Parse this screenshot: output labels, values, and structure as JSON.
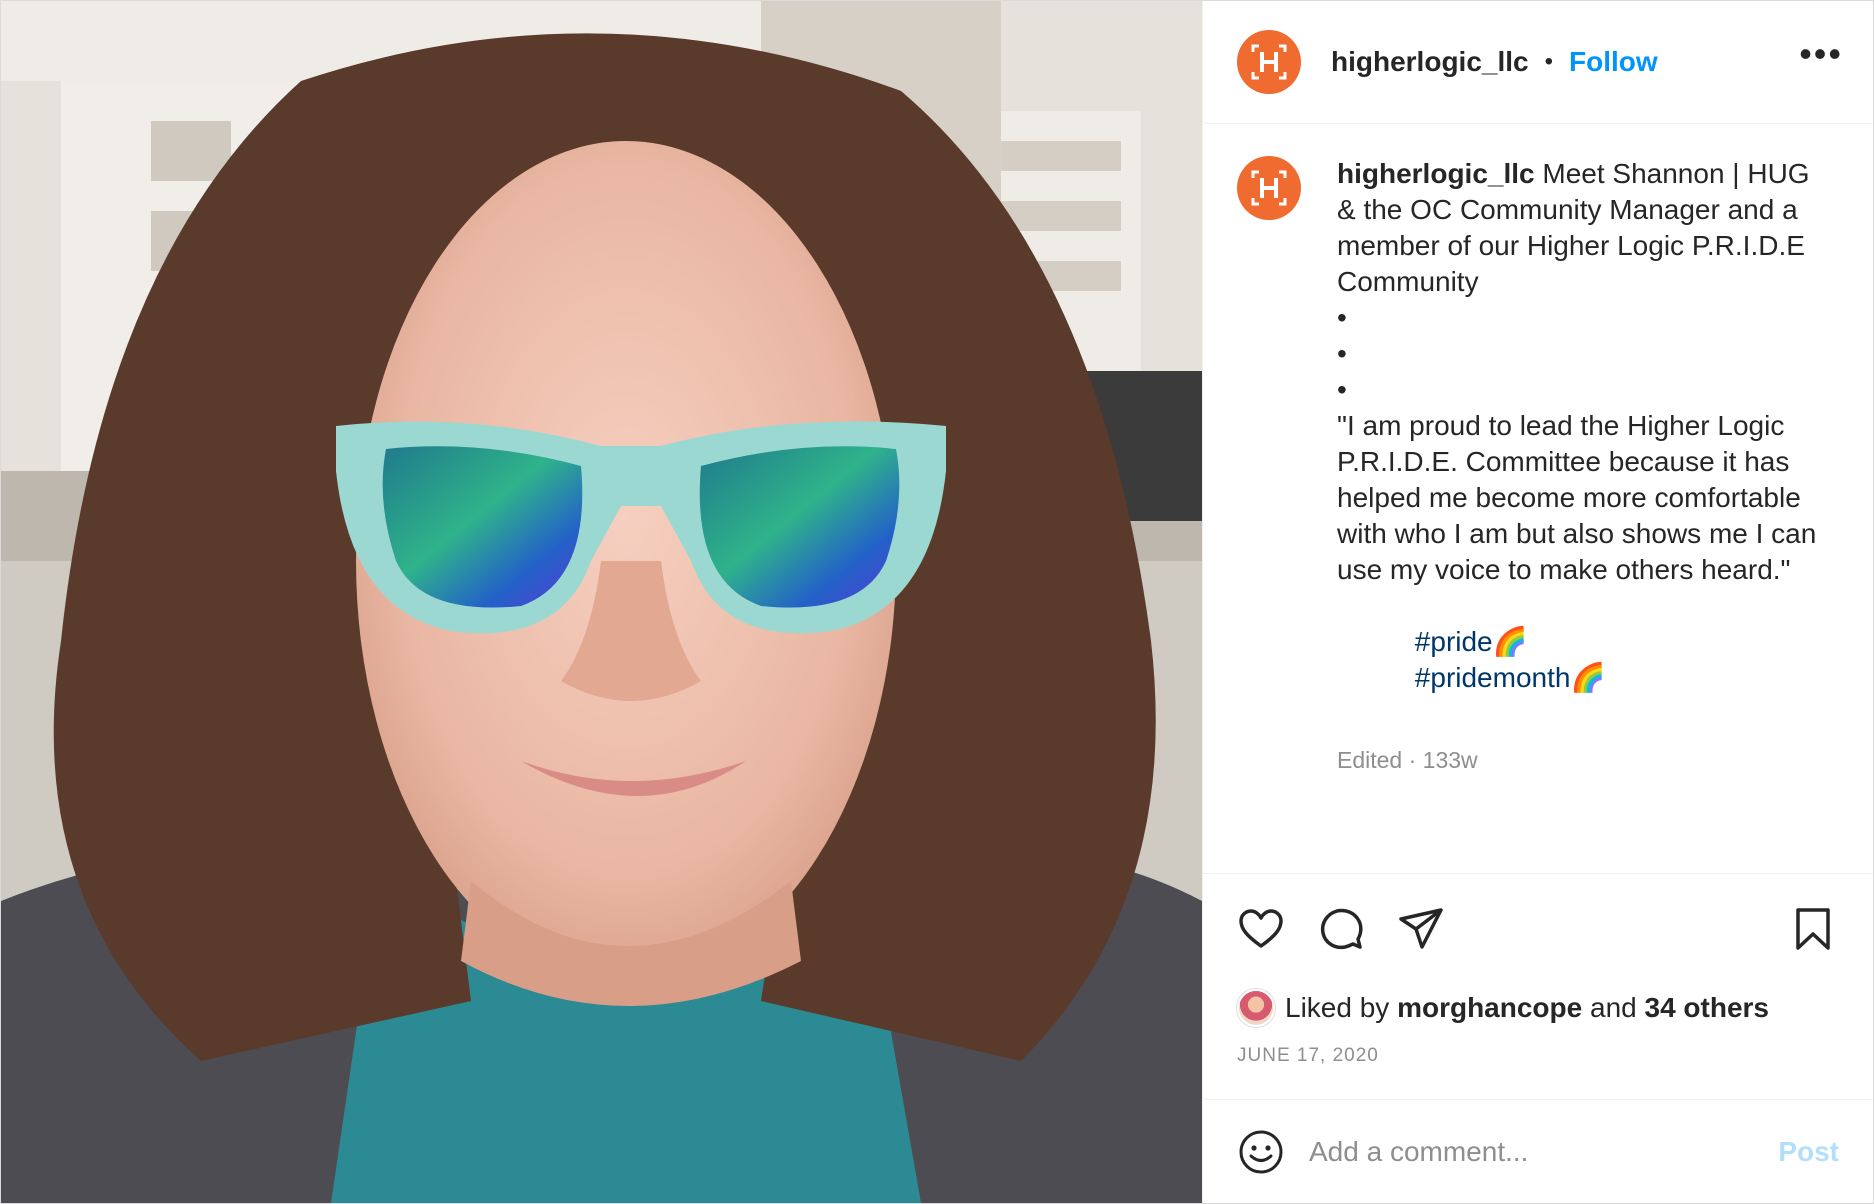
{
  "header": {
    "username": "higherlogic_llc",
    "separator": "•",
    "follow_label": "Follow",
    "more_label": "•••"
  },
  "caption": {
    "username": "higherlogic_llc",
    "text": "Meet Shannon | HUG & the OC Community Manager and a member of our Higher Logic P.R.I.D.E Community\n•\n•\n•\n\"I am proud to lead the Higher Logic P.R.I.D.E. Committee because it has helped me become more comfortable with who I am but also shows me I can use my voice to make others heard.\"",
    "hashtags": [
      "#pride🌈",
      "#pridemonth🌈"
    ],
    "edited": "Edited",
    "age": "133w"
  },
  "actions": {
    "icons": [
      "heart-icon",
      "comment-icon",
      "share-icon",
      "bookmark-icon"
    ]
  },
  "likes": {
    "prefix": "Liked by",
    "user": "morghancope",
    "middle": "and",
    "others": "34 others"
  },
  "date": "JUNE 17, 2020",
  "comment": {
    "placeholder": "Add a comment...",
    "post_label": "Post"
  },
  "colors": {
    "brand_orange": "#ef6b2f",
    "link_blue": "#0095f6",
    "hashtag_blue": "#00376b",
    "muted": "#8e8e8e"
  }
}
